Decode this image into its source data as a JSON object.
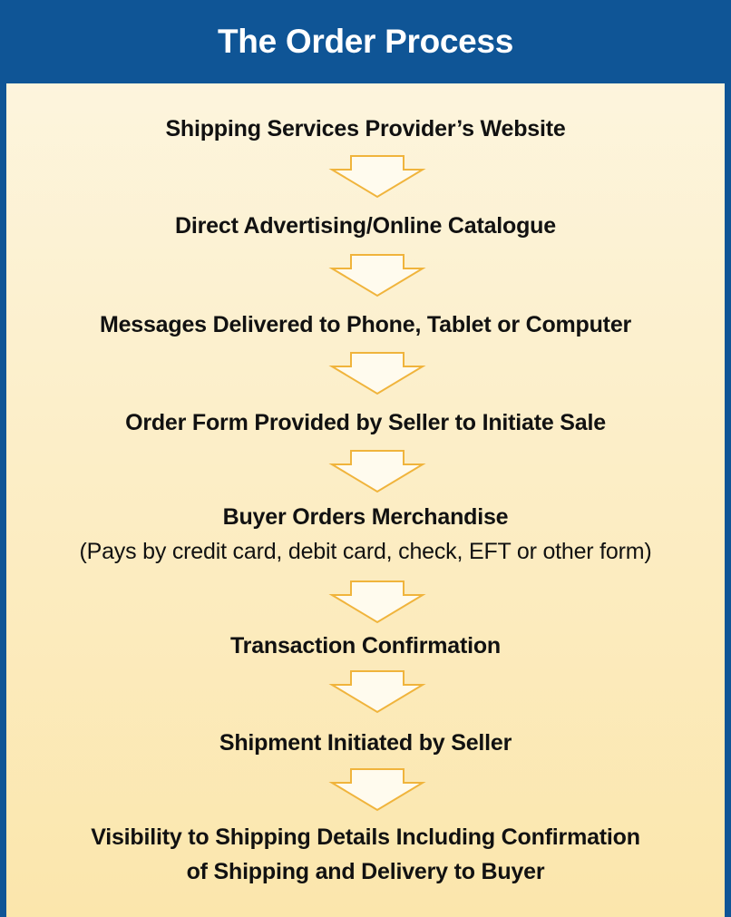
{
  "title": "The Order Process",
  "steps": [
    {
      "label": "Shipping Services Provider’s Website"
    },
    {
      "label": "Direct Advertising/Online Catalogue"
    },
    {
      "label": "Messages Delivered to Phone, Tablet or Computer"
    },
    {
      "label": "Order Form Provided by Seller to Initiate Sale"
    },
    {
      "label": "Buyer Orders Merchandise",
      "sub": "(Pays by credit card, debit card, check, EFT or other form)"
    },
    {
      "label": "Transaction Confirmation"
    },
    {
      "label": "Shipment Initiated by Seller"
    },
    {
      "label": "Visibility to Shipping Details Including Confirmation",
      "label2": "of Shipping and Delivery to Buyer"
    }
  ],
  "colors": {
    "header": "#0f5596",
    "arrow_fill": "#fffbee",
    "arrow_stroke": "#f0b43c"
  },
  "connector_icon": "down-arrow-icon"
}
